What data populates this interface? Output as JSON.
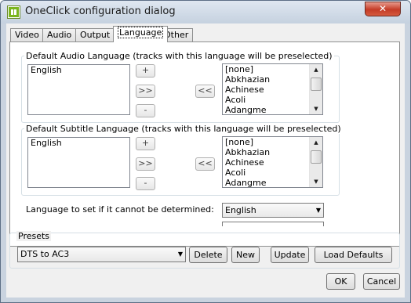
{
  "window": {
    "title": "OneClick configuration dialog",
    "close_glyph": "✕"
  },
  "tabs": [
    {
      "label": "Video"
    },
    {
      "label": "Audio"
    },
    {
      "label": "Output"
    },
    {
      "label": "Language"
    },
    {
      "label": "Other"
    }
  ],
  "audio": {
    "group_title": "Default Audio Language (tracks with this language will be preselected)",
    "selected_items": [
      "English"
    ],
    "available_items": [
      "[none]",
      "Abkhazian",
      "Achinese",
      "Acoli",
      "Adangme"
    ],
    "add_label": "+",
    "move_right_label": ">>",
    "remove_label": "-",
    "move_left_label": "<<"
  },
  "subtitle": {
    "group_title": "Default Subtitle Language (tracks with this language will be preselected)",
    "selected_items": [
      "English"
    ],
    "available_items": [
      "[none]",
      "Abkhazian",
      "Achinese",
      "Acoli",
      "Adangme"
    ],
    "add_label": "+",
    "move_right_label": ">>",
    "remove_label": "-",
    "move_left_label": "<<"
  },
  "fallback": {
    "label": "Language to set if it cannot be determined:",
    "value": "English"
  },
  "presets": {
    "title": "Presets",
    "value": "DTS to AC3",
    "delete_label": "Delete",
    "new_label": "New",
    "update_label": "Update",
    "load_defaults_label": "Load Defaults"
  },
  "footer": {
    "ok_label": "OK",
    "cancel_label": "Cancel"
  }
}
